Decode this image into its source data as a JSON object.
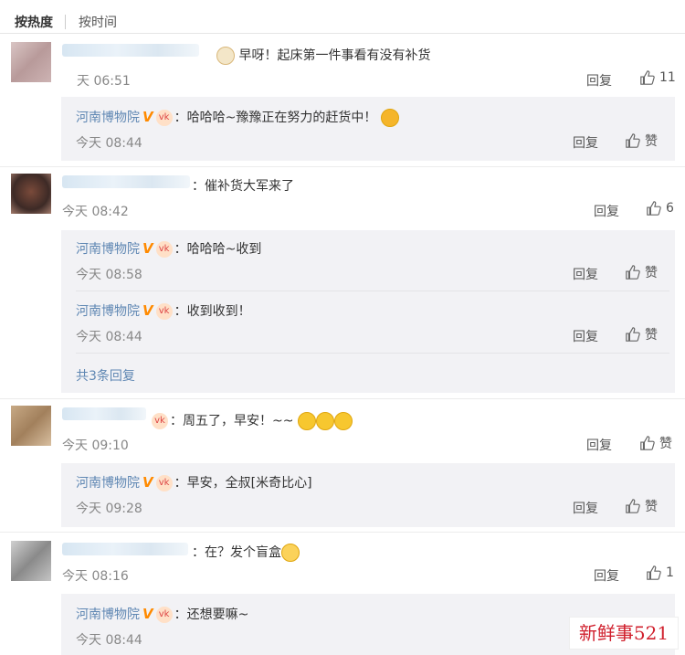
{
  "sort": {
    "hot": "按热度",
    "time": "按时间"
  },
  "reply_label": "回复",
  "like_label": "赞",
  "museum_name": "河南博物院",
  "comments": [
    {
      "text": "早呀！起床第一件事看有没有补货",
      "time": "天 06:51",
      "likes": "11",
      "replies": [
        {
          "text": "：哈哈哈~豫豫正在努力的赶货中！",
          "time": "今天 08:44"
        }
      ]
    },
    {
      "text": "：催补货大军来了",
      "time": "今天 08:42",
      "likes": "6",
      "replies": [
        {
          "text": "：哈哈哈~收到",
          "time": "今天 08:58"
        },
        {
          "text": "：收到收到！",
          "time": "今天 08:44"
        }
      ],
      "more": "共3条回复"
    },
    {
      "text": "：周五了，早安！~~",
      "time": "今天 09:10",
      "likes": "赞",
      "replies": [
        {
          "text": "：早安，全叔[米奇比心]",
          "time": "今天 09:28"
        }
      ]
    },
    {
      "text": "：在？发个盲盒",
      "time": "今天 08:16",
      "likes": "1",
      "replies": [
        {
          "text": "：还想要嘛~",
          "time": "今天 08:44"
        }
      ]
    }
  ],
  "watermark": "新鲜事521"
}
